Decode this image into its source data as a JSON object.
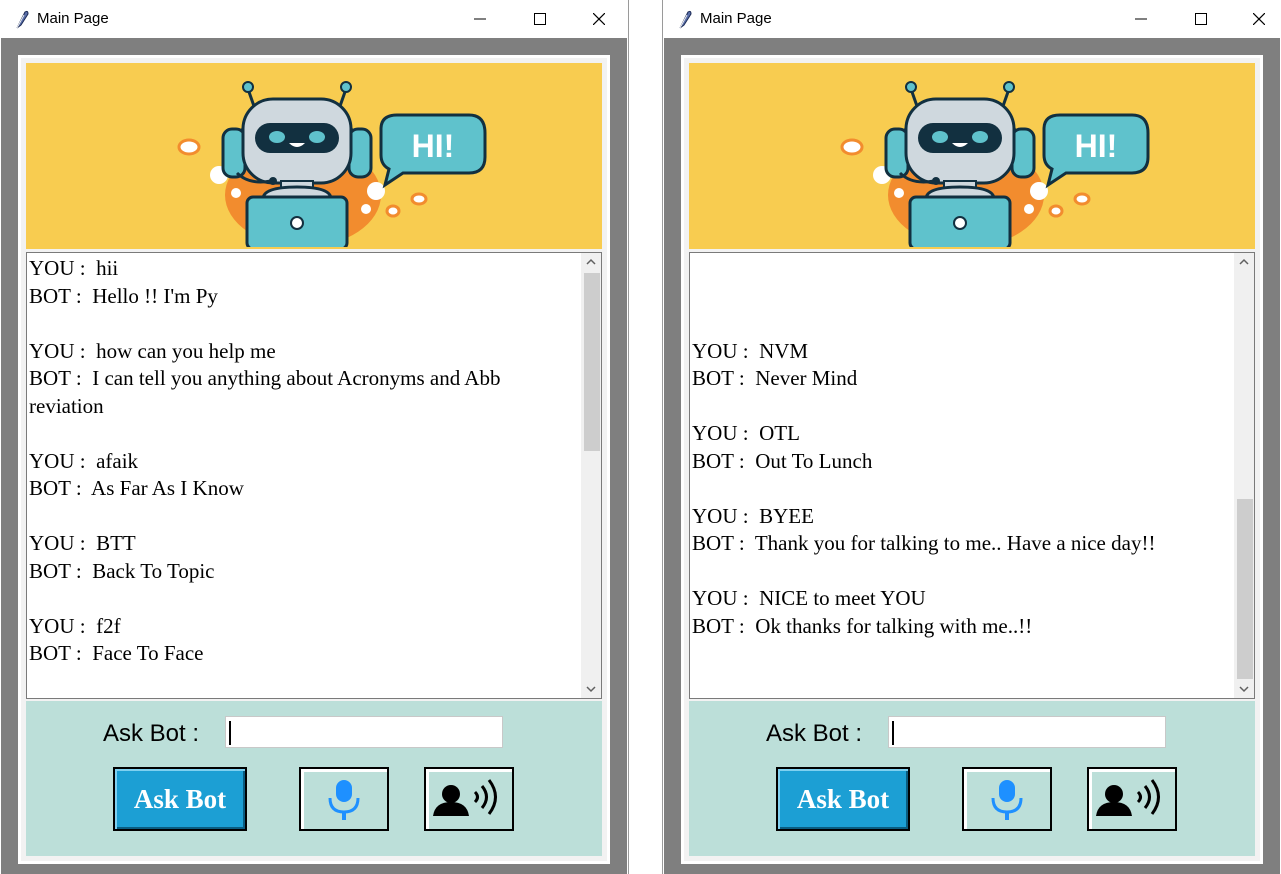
{
  "windows": [
    {
      "title": "Main Page",
      "chat_lines": [
        "YOU :  hii",
        "BOT :  Hello !! I'm Py",
        "",
        "YOU :  how can you help me",
        "BOT :  I can tell you anything about Acronyms and Abb",
        "reviation",
        "",
        "YOU :  afaik",
        "BOT :  As Far As I Know",
        "",
        "YOU :  BTT",
        "BOT :  Back To Topic",
        "",
        "YOU :  f2f",
        "BOT :  Face To Face"
      ],
      "ask_label": "Ask Bot :",
      "ask_input_value": "",
      "ask_button_label": "Ask Bot",
      "banner_text": "HI!"
    },
    {
      "title": "Main Page",
      "chat_lines": [
        "",
        "",
        "",
        "YOU :  NVM",
        "BOT :  Never Mind",
        "",
        "YOU :  OTL",
        "BOT :  Out To Lunch",
        "",
        "YOU :  BYEE",
        "BOT :  Thank you for talking to me.. Have a nice day!!",
        "",
        "YOU :  NICE to meet YOU",
        "BOT :  Ok thanks for talking with me..!!"
      ],
      "ask_label": "Ask Bot :",
      "ask_input_value": "",
      "ask_button_label": "Ask Bot",
      "banner_text": "HI!"
    }
  ],
  "icons": {
    "app": "feather-icon",
    "minimize": "minimize-icon",
    "maximize": "maximize-icon",
    "close": "close-icon",
    "mic": "microphone-icon",
    "speak": "speaker-person-icon"
  },
  "colors": {
    "banner_bg": "#f8cc50",
    "bottom_bg": "#bcdfd9",
    "ask_button_bg": "#1c9fd4",
    "mic_color": "#1e90ff"
  }
}
